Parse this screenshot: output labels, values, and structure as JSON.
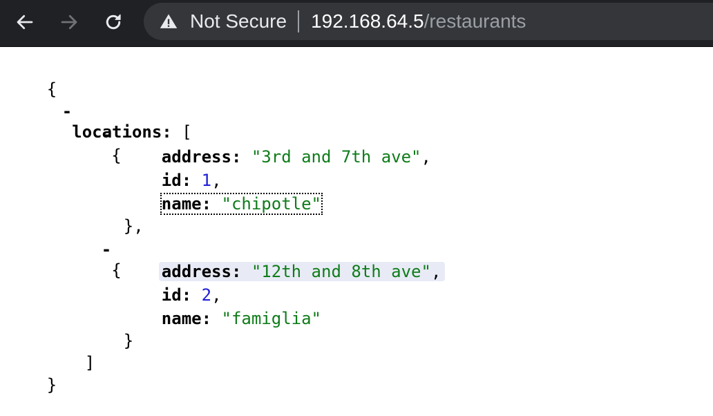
{
  "browser": {
    "security_label": "Not Secure",
    "url_host": "192.168.64.5",
    "url_path": "/restaurants",
    "icons": [
      "back-arrow-icon",
      "forward-arrow-icon",
      "reload-icon",
      "warning-triangle-icon"
    ]
  },
  "json": {
    "open_brace": "{",
    "close_brace": "}",
    "collapse_marker": "-",
    "root_key": "locations",
    "open_bracket": "[",
    "close_bracket": "]",
    "items": [
      {
        "open": "{",
        "close": "},",
        "address_key": "address",
        "address_value": "\"3rd and 7th ave\"",
        "id_key": "id",
        "id_value": "1",
        "name_key": "name",
        "name_value": "\"chipotle\""
      },
      {
        "open": "{",
        "close": "}",
        "address_key": "address",
        "address_value": "\"12th and 8th ave\"",
        "id_key": "id",
        "id_value": "2",
        "name_key": "name",
        "name_value": "\"famiglia\""
      }
    ]
  },
  "colors": {
    "toolbar_bg": "#202124",
    "omnibox_bg": "#35363a",
    "string": "#0f7c1a",
    "number": "#1d1dd6",
    "hover_highlight": "#e8ebf5"
  }
}
